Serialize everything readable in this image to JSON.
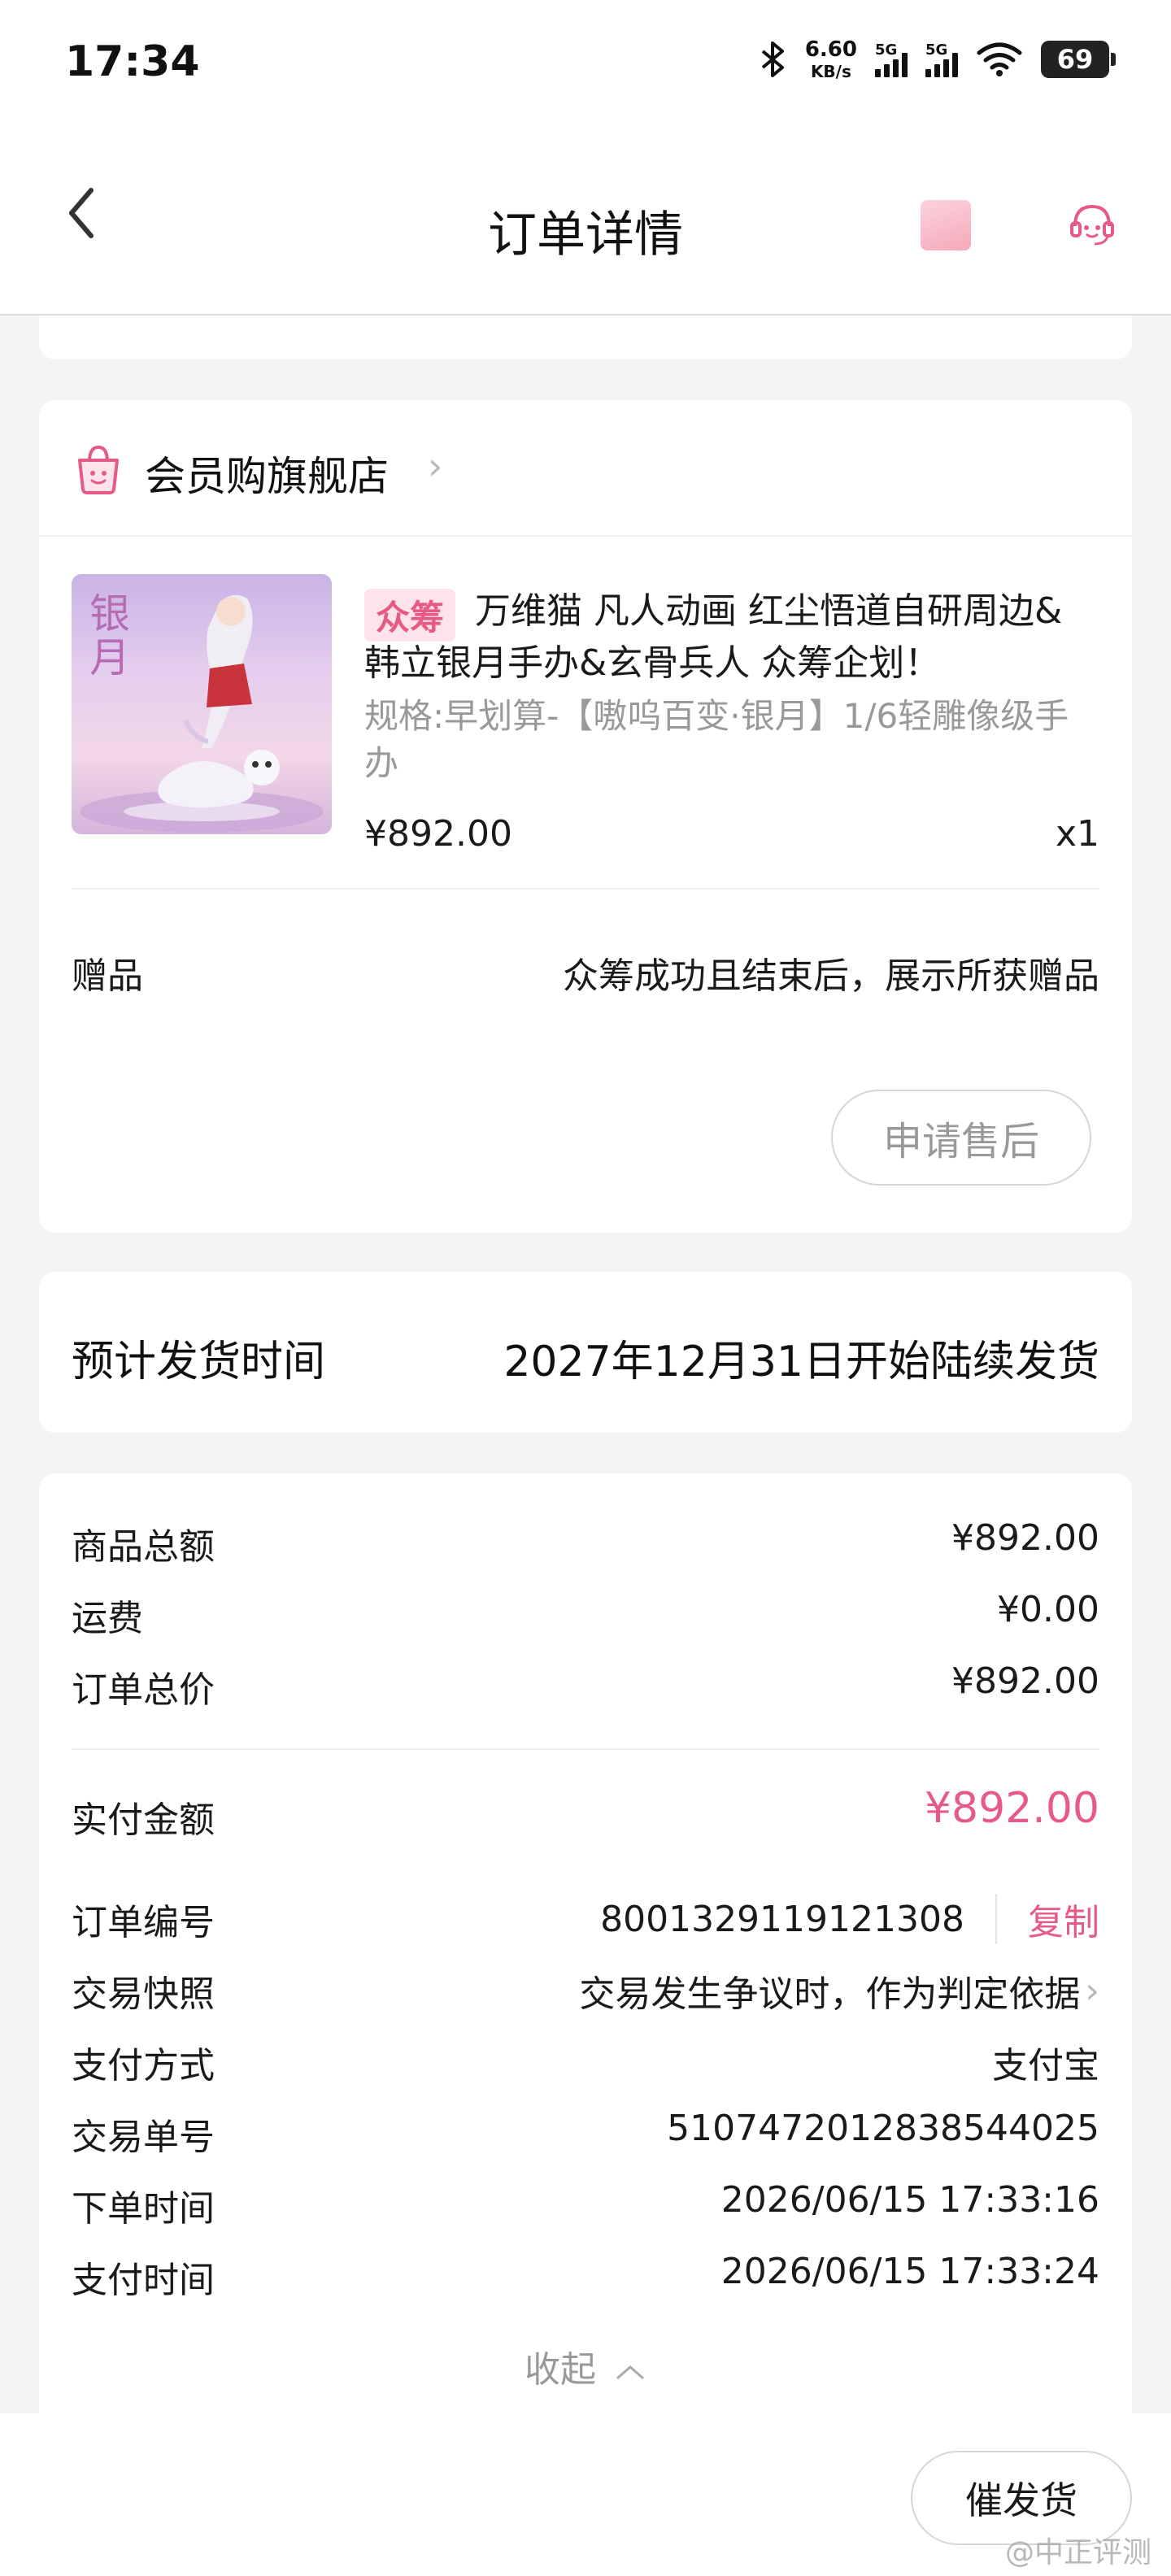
{
  "status_bar": {
    "time": "17:34",
    "net_speed_value": "6.60",
    "net_speed_unit": "KB/s",
    "signal1_label": "5G",
    "signal2_label": "5G",
    "battery": "69",
    "icons": [
      "bluetooth-icon",
      "signal-icon",
      "signal-icon",
      "wifi-icon",
      "battery-icon"
    ]
  },
  "header": {
    "title": "订单详情",
    "back_icon": "chevron-left-icon",
    "promo_icon": "promo-sticker-icon",
    "service_icon": "customer-service-icon"
  },
  "store": {
    "name": "会员购旗舰店",
    "chevron": "›",
    "icon": "shopping-bag-icon"
  },
  "product": {
    "tag": "众筹",
    "title": "万维猫 凡人动画 红尘悟道自研周边&韩立银月手办&玄骨兵人 众筹企划！",
    "spec": "规格:早划算-【嗷呜百变·银月】1/6轻雕像级手办",
    "price": "¥892.00",
    "qty": "x1"
  },
  "gift": {
    "label": "赠品",
    "value": "众筹成功且结束后，展示所获赠品"
  },
  "actions": {
    "after_sale": "申请售后",
    "urge_ship": "催发货"
  },
  "shipping": {
    "label": "预计发货时间",
    "value": "2027年12月31日开始陆续发货"
  },
  "summary": {
    "goods_total_label": "商品总额",
    "goods_total": "¥892.00",
    "freight_label": "运费",
    "freight": "¥0.00",
    "order_total_label": "订单总价",
    "order_total": "¥892.00",
    "paid_label": "实付金额",
    "paid": "¥892.00"
  },
  "details": {
    "order_no_label": "订单编号",
    "order_no": "8001329119121308",
    "copy": "复制",
    "snapshot_label": "交易快照",
    "snapshot_value": "交易发生争议时，作为判定依据",
    "snapshot_chevron": "›",
    "pay_method_label": "支付方式",
    "pay_method": "支付宝",
    "trade_no_label": "交易单号",
    "trade_no": "5107472012838544025",
    "order_time_label": "下单时间",
    "order_time": "2026/06/15 17:33:16",
    "pay_time_label": "支付时间",
    "pay_time": "2026/06/15 17:33:24",
    "collapse": "收起"
  },
  "watermark": "@中正评测",
  "colors": {
    "accent": "#e85a86",
    "background": "#f4f4f4",
    "card": "#ffffff",
    "muted_text": "#999999"
  }
}
